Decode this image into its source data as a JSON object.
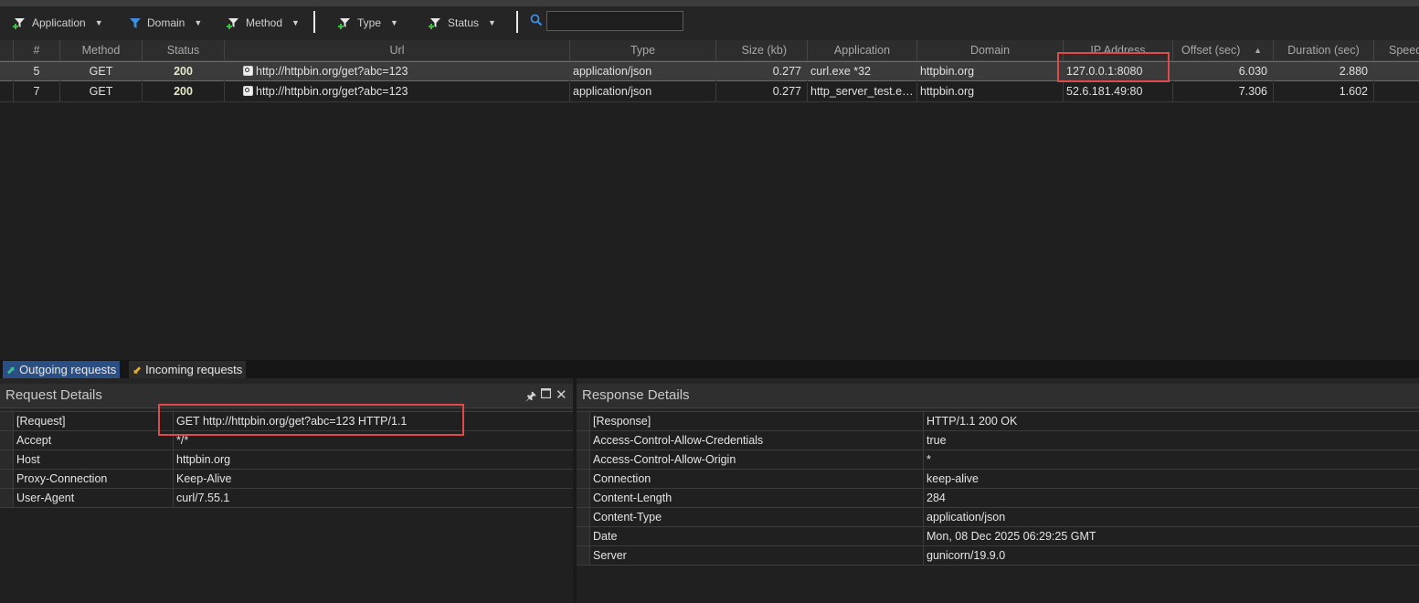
{
  "toolbar": {
    "filters": [
      {
        "label": "Application"
      },
      {
        "label": "Domain"
      },
      {
        "label": "Method"
      },
      {
        "label": "Type"
      },
      {
        "label": "Status"
      }
    ],
    "search_value": ""
  },
  "grid": {
    "columns": [
      "#",
      "Method",
      "Status",
      "Url",
      "Type",
      "Size (kb)",
      "Application",
      "Domain",
      "IP Address",
      "Offset (sec)",
      "Duration (sec)",
      "Speed"
    ],
    "sort_indicator": "▲",
    "rows": [
      {
        "num": "5",
        "method": "GET",
        "status": "200",
        "url": "http://httpbin.org/get?abc=123",
        "type": "application/json",
        "size": "0.277",
        "application": "curl.exe *32",
        "domain": "httpbin.org",
        "ip": "127.0.0.1:8080",
        "offset": "6.030",
        "duration": "2.880",
        "speed": ""
      },
      {
        "num": "7",
        "method": "GET",
        "status": "200",
        "url": "http://httpbin.org/get?abc=123",
        "type": "application/json",
        "size": "0.277",
        "application": "http_server_test.ex...",
        "domain": "httpbin.org",
        "ip": "52.6.181.49:80",
        "offset": "7.306",
        "duration": "1.602",
        "speed": ""
      }
    ]
  },
  "tabs": {
    "outgoing": "Outgoing requests",
    "incoming": "Incoming requests"
  },
  "request_details": {
    "title": "Request Details",
    "rows": [
      {
        "key": "[Request]",
        "value": "GET http://httpbin.org/get?abc=123 HTTP/1.1"
      },
      {
        "key": "Accept",
        "value": "*/*"
      },
      {
        "key": "Host",
        "value": "httpbin.org"
      },
      {
        "key": "Proxy-Connection",
        "value": "Keep-Alive"
      },
      {
        "key": "User-Agent",
        "value": "curl/7.55.1"
      }
    ]
  },
  "response_details": {
    "title": "Response Details",
    "rows": [
      {
        "key": "[Response]",
        "value": "HTTP/1.1 200 OK"
      },
      {
        "key": "Access-Control-Allow-Credentials",
        "value": "true"
      },
      {
        "key": "Access-Control-Allow-Origin",
        "value": "*"
      },
      {
        "key": "Connection",
        "value": "keep-alive"
      },
      {
        "key": "Content-Length",
        "value": "284"
      },
      {
        "key": "Content-Type",
        "value": "application/json"
      },
      {
        "key": "Date",
        "value": "Mon, 08 Dec 2025 06:29:25 GMT"
      },
      {
        "key": "Server",
        "value": "gunicorn/19.9.0"
      }
    ]
  },
  "colors": {
    "accent_red": "#e14a4a",
    "tab_active": "#2a4f84",
    "filter_blue": "#3b8fe0",
    "filter_green": "#3fbf3f"
  }
}
